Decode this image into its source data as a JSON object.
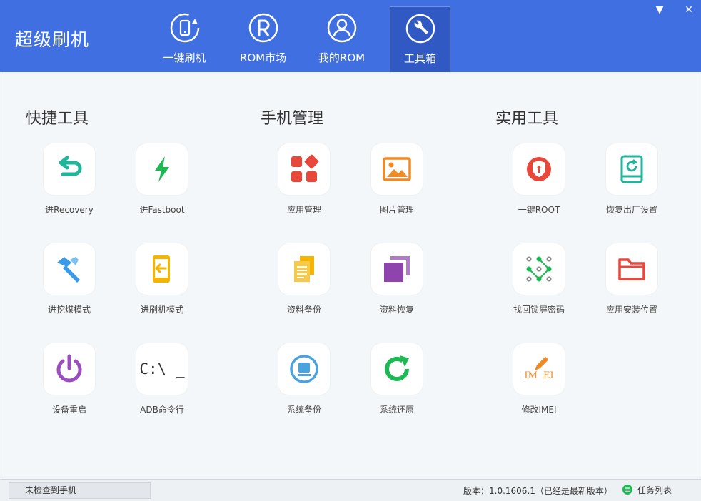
{
  "app": {
    "title": "超级刷机"
  },
  "nav": {
    "tabs": [
      {
        "label": "一键刷机",
        "icon": "phone-refresh-icon"
      },
      {
        "label": "ROM市场",
        "icon": "rom-r-icon"
      },
      {
        "label": "我的ROM",
        "icon": "user-icon"
      },
      {
        "label": "工具箱",
        "icon": "wrench-icon",
        "active": true
      }
    ]
  },
  "window": {
    "menu_glyph": "▼",
    "close_glyph": "✕"
  },
  "sections": [
    {
      "title": "快捷工具",
      "tools": [
        {
          "label": "进Recovery",
          "icon": "return-arrow-icon",
          "color": "#1fb59a"
        },
        {
          "label": "进Fastboot",
          "icon": "lightning-icon",
          "color": "#1db954"
        },
        {
          "label": "进挖煤模式",
          "icon": "hammer-icon",
          "color": "#3a9ae8"
        },
        {
          "label": "进刷机模式",
          "icon": "phone-arrow-icon",
          "color": "#f4b400"
        },
        {
          "label": "设备重启",
          "icon": "power-icon",
          "color": "#9b4fbf"
        },
        {
          "label": "ADB命令行",
          "icon": "terminal-icon",
          "glyph": "C:\\ _",
          "color": "#333333"
        }
      ]
    },
    {
      "title": "手机管理",
      "tools": [
        {
          "label": "应用管理",
          "icon": "apps-grid-icon",
          "color": "#e8473b"
        },
        {
          "label": "图片管理",
          "icon": "picture-icon",
          "color": "#f08a24"
        },
        {
          "label": "资料备份",
          "icon": "documents-icon",
          "color": "#f4b400"
        },
        {
          "label": "资料恢复",
          "icon": "layers-icon",
          "color": "#8e44ad"
        },
        {
          "label": "系统备份",
          "icon": "disk-backup-icon",
          "color": "#4aa3df"
        },
        {
          "label": "系统还原",
          "icon": "refresh-icon",
          "color": "#1db954"
        }
      ]
    },
    {
      "title": "实用工具",
      "tools": [
        {
          "label": "一键ROOT",
          "icon": "shield-lock-icon",
          "color": "#e8473b"
        },
        {
          "label": "恢复出厂设置",
          "icon": "restore-device-icon",
          "color": "#1fb59a"
        },
        {
          "label": "找回锁屏密码",
          "icon": "pattern-lock-icon",
          "color": "#1db954"
        },
        {
          "label": "应用安装位置",
          "icon": "folder-icon",
          "color": "#e8473b"
        },
        {
          "label": "修改IMEI",
          "icon": "imei-edit-icon",
          "glyph": "IM EI",
          "color": "#f08a24"
        }
      ]
    }
  ],
  "status": {
    "device": "未检查到手机",
    "version": "版本：1.0.1606.1（已经是最新版本）",
    "task_list": "任务列表"
  }
}
